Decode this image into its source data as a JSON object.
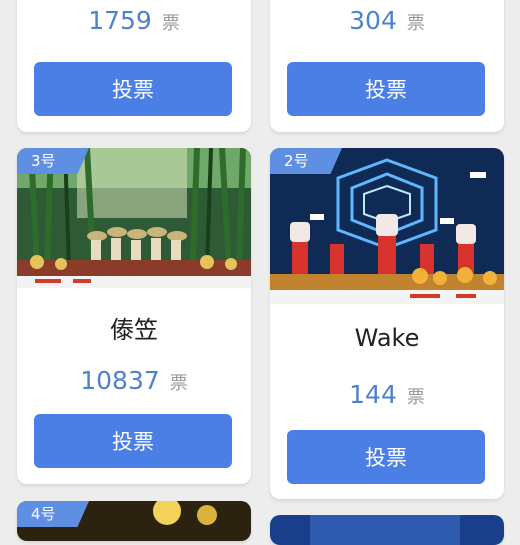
{
  "vote_unit": "票",
  "vote_button_label": "投票",
  "entries": [
    {
      "votes": "1759"
    },
    {
      "votes": "304"
    },
    {
      "badge": "3号",
      "title": "傣笠",
      "votes": "10837"
    },
    {
      "badge": "2号",
      "title": "Wake",
      "votes": "144"
    },
    {
      "badge": "4号"
    }
  ],
  "colors": {
    "accent": "#4b7fe6",
    "vote_number": "#4f82cc",
    "badge": "#5f8fe3",
    "background": "#ededed"
  }
}
